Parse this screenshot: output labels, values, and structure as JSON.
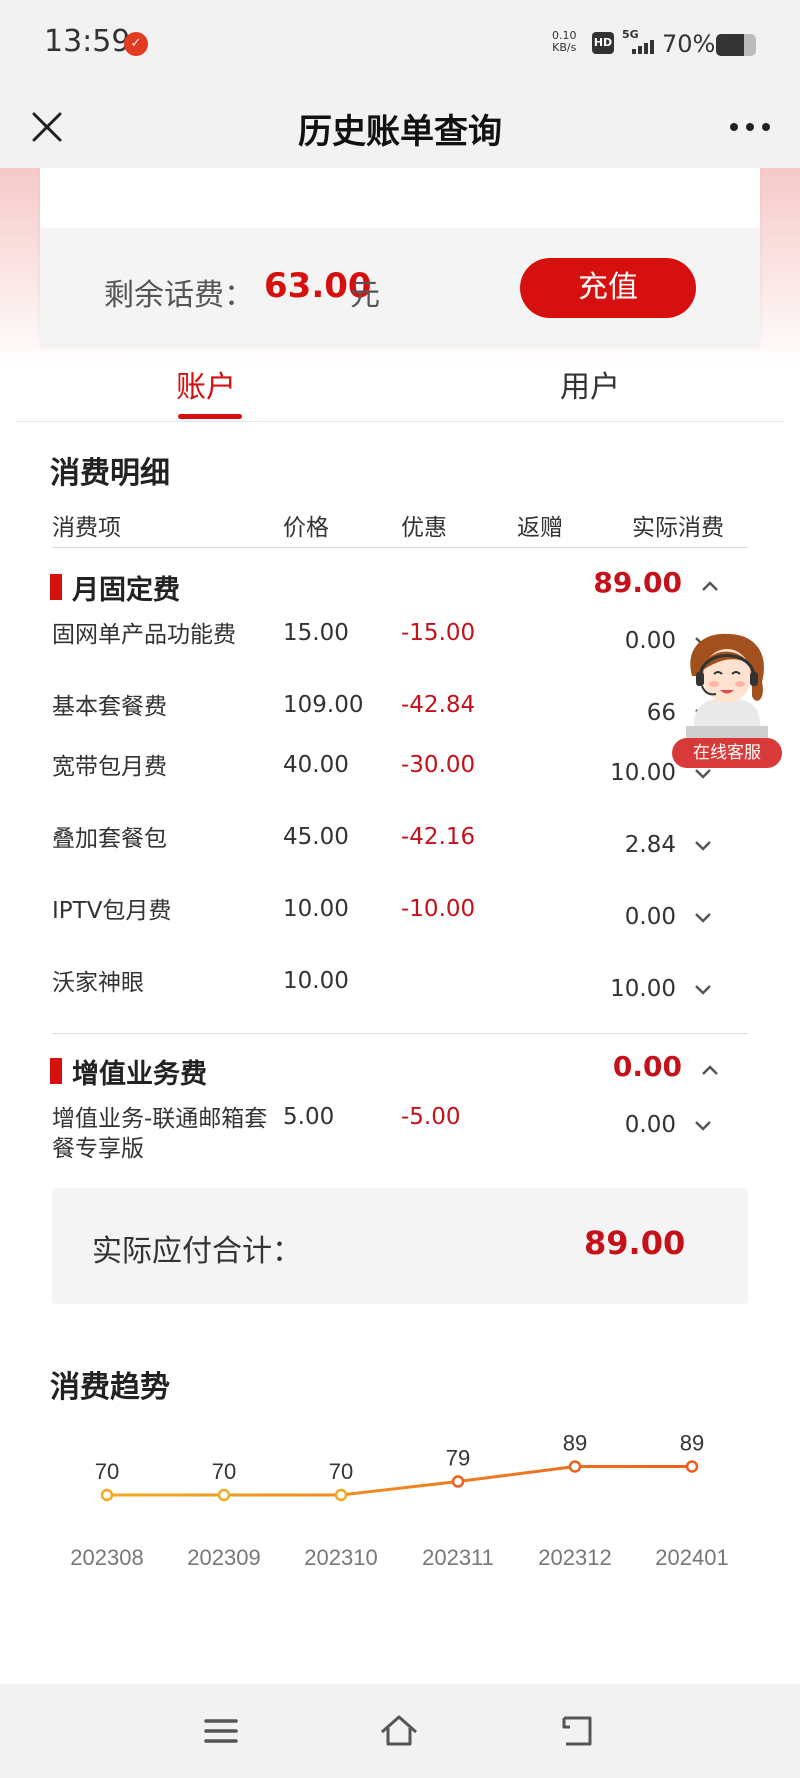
{
  "status_bar": {
    "time": "13:59",
    "net_speed": "0.10",
    "net_unit": "KB/s",
    "hd": "HD",
    "signal": "5G",
    "battery": "70%",
    "battery_level": 0.7
  },
  "header": {
    "title": "历史账单查询",
    "close_icon": "close-icon",
    "more_icon": "more-icon"
  },
  "balance": {
    "label": "剩余话费：",
    "amount": "63.00",
    "unit": "元",
    "recharge_label": "充值"
  },
  "tabs": [
    {
      "label": "账户",
      "active": true
    },
    {
      "label": "用户",
      "active": false
    }
  ],
  "detail": {
    "title": "消费明细",
    "columns": [
      "消费项",
      "价格",
      "优惠",
      "返赠",
      "实际消费"
    ],
    "groups": [
      {
        "name": "月固定费",
        "total": "89.00",
        "items": [
          {
            "name": "固网单产品功能费",
            "price": "15.00",
            "discount": "-15.00",
            "actual": "0.00"
          },
          {
            "name": "基本套餐费",
            "price": "109.00",
            "discount": "-42.84",
            "actual": "66"
          },
          {
            "name": "宽带包月费",
            "price": "40.00",
            "discount": "-30.00",
            "actual": "10.00"
          },
          {
            "name": "叠加套餐包",
            "price": "45.00",
            "discount": "-42.16",
            "actual": "2.84"
          },
          {
            "name": "IPTV包月费",
            "price": "10.00",
            "discount": "-10.00",
            "actual": "0.00"
          },
          {
            "name": "沃家神眼",
            "price": "10.00",
            "discount": "",
            "actual": "10.00"
          }
        ]
      },
      {
        "name": "增值业务费",
        "total": "0.00",
        "items": [
          {
            "name": "增值业务-联通邮箱套餐专享版",
            "price": "5.00",
            "discount": "-5.00",
            "actual": "0.00"
          }
        ]
      }
    ],
    "total_label": "实际应付合计：",
    "total_value": "89.00"
  },
  "trend": {
    "title": "消费趋势"
  },
  "customer_service": {
    "label": "在线客服"
  },
  "chart_data": {
    "type": "line",
    "categories": [
      "202308",
      "202309",
      "202310",
      "202311",
      "202312",
      "202401"
    ],
    "values": [
      70,
      70,
      70,
      79,
      89,
      89
    ],
    "title": "消费趋势",
    "xlabel": "",
    "ylabel": "",
    "colors": [
      "#f2a91f",
      "#ee5f1d"
    ],
    "point_fill": "#ffffff"
  },
  "nav": [
    "menu-icon",
    "home-icon",
    "back-icon"
  ]
}
